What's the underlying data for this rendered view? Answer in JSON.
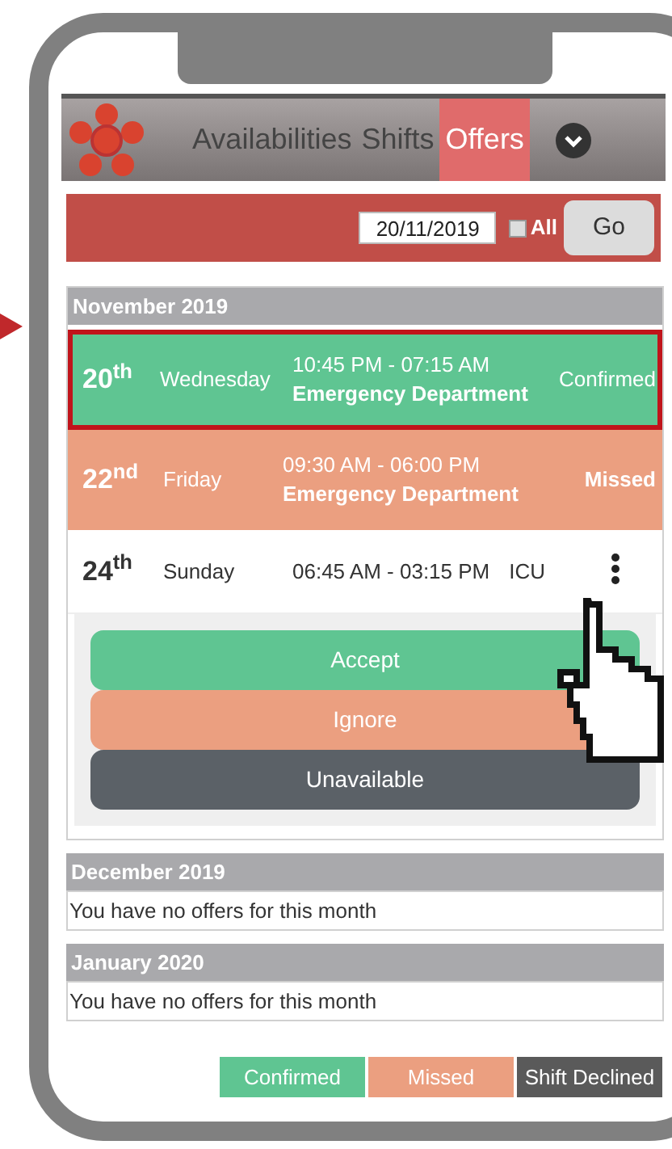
{
  "nav": {
    "tabs": [
      {
        "label": "Availabilities",
        "selected": false
      },
      {
        "label": "Shifts",
        "selected": false
      },
      {
        "label": "Offers",
        "selected": true
      }
    ]
  },
  "filter": {
    "date": "20/11/2019",
    "all_checked": false,
    "all_label": "All",
    "go": "Go"
  },
  "months": [
    {
      "title": "November 2019",
      "offers": [
        {
          "day": "20$^{th}$",
          "weekday": "Wednesday",
          "time": "10:45 PM - 07:15 AM",
          "department": "Emergency Department",
          "kind": "confirmed",
          "status_label": "Confirmed",
          "highlighted": true
        },
        {
          "day": "22$^{nd}$",
          "weekday": "Friday",
          "time": "09:30 AM - 06:00 PM",
          "department": "Emergency Department",
          "kind": "missed",
          "status_label": "Missed",
          "highlighted": false
        },
        {
          "day": "24$^{th}$",
          "weekday": "Sunday",
          "time": "06:45 AM - 03:15 PM",
          "department": "ICU",
          "kind": "pending",
          "highlighted": false,
          "expanded": true,
          "actions": [
            {
              "label": "Accept",
              "kind": "accept"
            },
            {
              "label": "Ignore",
              "kind": "ignore"
            },
            {
              "label": "Unavailable",
              "kind": "unavailable"
            }
          ]
        }
      ]
    },
    {
      "title": "December 2019",
      "message": "You have no offers for this month"
    },
    {
      "title": "January 2020",
      "message": "You have no offers for this month"
    }
  ],
  "legend": [
    {
      "label": "Confirmed",
      "kind": "confirmed"
    },
    {
      "label": "Missed",
      "kind": "missed"
    },
    {
      "label": "Shift Declined",
      "kind": "declined"
    }
  ]
}
